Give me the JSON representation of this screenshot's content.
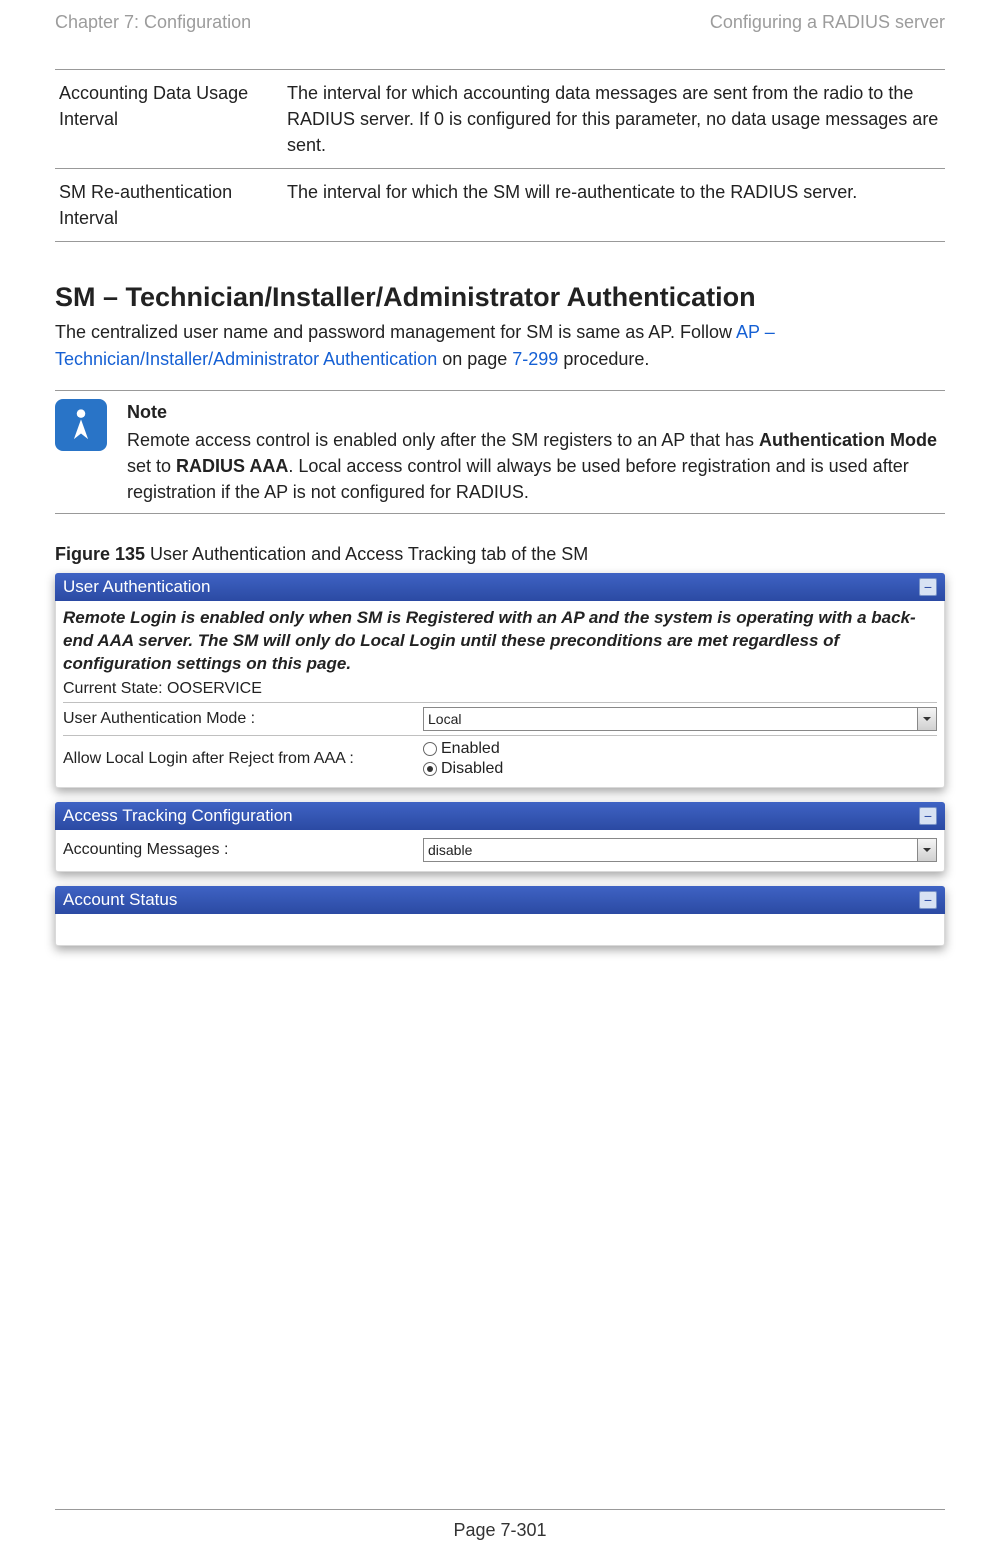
{
  "header": {
    "left": "Chapter 7:  Configuration",
    "right": "Configuring a RADIUS server"
  },
  "paramsTable": {
    "rows": [
      {
        "name": "Accounting Data Usage Interval",
        "desc": "The interval for which accounting data messages are sent from the radio to the RADIUS server. If 0 is configured for this parameter, no data usage messages are sent."
      },
      {
        "name": "SM Re-authentication Interval",
        "desc": "The interval for which the SM will re-authenticate to the RADIUS server."
      }
    ]
  },
  "section": {
    "title": "SM – Technician/Installer/Administrator Authentication",
    "para_before": "The centralized user name and password management for SM is same as AP. Follow ",
    "link_text": "AP – Technician/Installer/Administrator Authentication",
    "para_mid": " on page ",
    "page_ref": "7-299",
    "para_after": " procedure."
  },
  "note": {
    "title": "Note",
    "body_before": "Remote access control is enabled only after the SM registers to an AP that has ",
    "bold1": "Authentication Mode",
    "mid1": " set to ",
    "bold2": "RADIUS AAA",
    "body_after": ". Local access control will always be used before registration and is used after registration if the AP is not configured for RADIUS."
  },
  "figure": {
    "number": "Figure 135",
    "caption": " User Authentication and Access Tracking tab of the SM"
  },
  "shot": {
    "panel1": {
      "title": "User Authentication",
      "italic_note": "Remote Login is enabled only when SM is Registered with an AP and the system is operating with a back-end AAA server. The SM will only do Local Login until these preconditions are met regardless of configuration settings on this page.",
      "state_label": "Current State: ",
      "state_value": "OOSERVICE",
      "auth_mode_label": "User Authentication Mode :",
      "auth_mode_value": "Local",
      "allow_local_label": "Allow Local Login after Reject from AAA :",
      "opt_enabled": "Enabled",
      "opt_disabled": "Disabled"
    },
    "panel2": {
      "title": "Access Tracking Configuration",
      "acct_msgs_label": "Accounting Messages :",
      "acct_msgs_value": "disable"
    },
    "panel3": {
      "title": "Account Status"
    }
  },
  "footer": {
    "page": "Page 7-301"
  }
}
